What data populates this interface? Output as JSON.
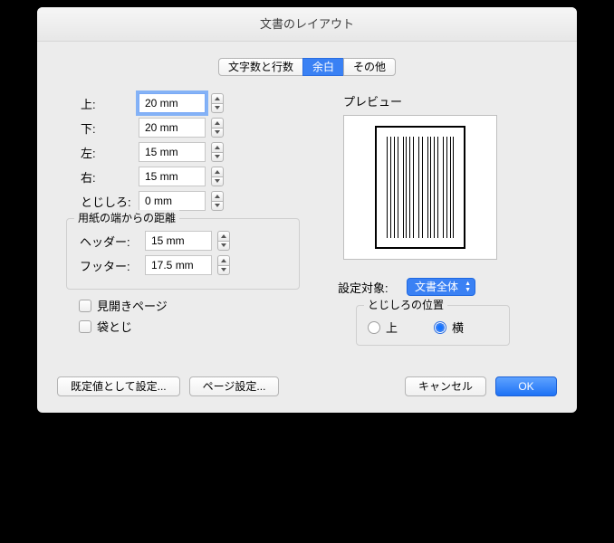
{
  "title": "文書のレイアウト",
  "tabs": {
    "chars": "文字数と行数",
    "margins": "余白",
    "other": "その他",
    "active": "margins"
  },
  "margins": {
    "top": {
      "label": "上:",
      "value": "20 mm"
    },
    "bottom": {
      "label": "下:",
      "value": "20 mm"
    },
    "left": {
      "label": "左:",
      "value": "15 mm"
    },
    "right": {
      "label": "右:",
      "value": "15 mm"
    },
    "gutter": {
      "label": "とじしろ:",
      "value": "0 mm"
    }
  },
  "edge": {
    "group_label": "用紙の端からの距離",
    "header": {
      "label": "ヘッダー:",
      "value": "15 mm"
    },
    "footer": {
      "label": "フッター:",
      "value": "17.5 mm"
    }
  },
  "facing_pages": {
    "label": "見開きページ",
    "checked": false
  },
  "book_fold": {
    "label": "袋とじ",
    "checked": false
  },
  "preview_label": "プレビュー",
  "apply_to": {
    "label": "設定対象:",
    "selected": "文書全体"
  },
  "gutter_pos": {
    "group_label": "とじしろの位置",
    "top": {
      "label": "上",
      "checked": false
    },
    "side": {
      "label": "横",
      "checked": true
    }
  },
  "buttons": {
    "defaults": "既定値として設定...",
    "page_setup": "ページ設定...",
    "cancel": "キャンセル",
    "ok": "OK"
  }
}
